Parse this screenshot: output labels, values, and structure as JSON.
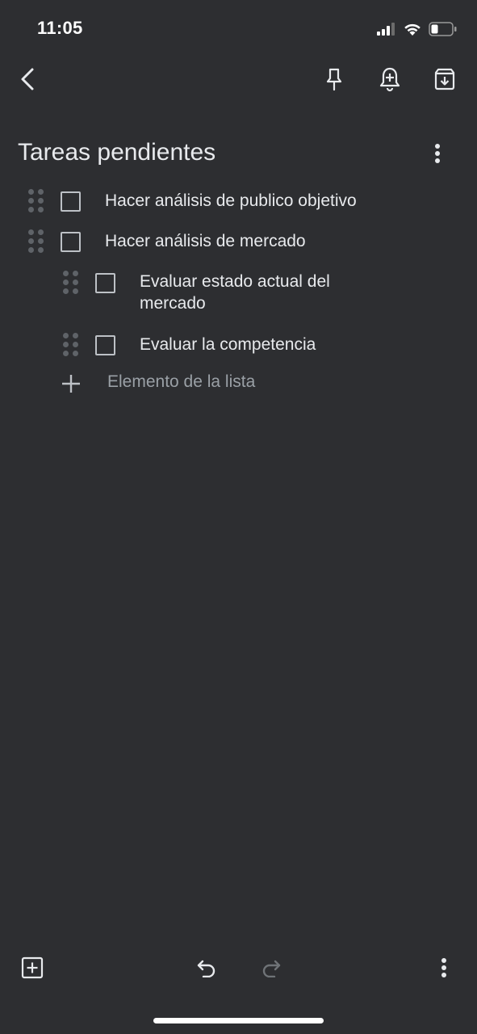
{
  "status_bar": {
    "time": "11:05",
    "icons": [
      "cellular-signal-icon",
      "wifi-icon",
      "battery-icon"
    ]
  },
  "toolbar": {
    "icons": [
      "back-arrow-icon",
      "pin-icon",
      "add-reminder-icon",
      "archive-icon"
    ]
  },
  "note": {
    "title": "Tareas pendientes",
    "items": [
      {
        "text": "Hacer análisis de publico objetivo",
        "checked": false,
        "indent": 0
      },
      {
        "text": "Hacer análisis de mercado",
        "checked": false,
        "indent": 0
      },
      {
        "text": "Evaluar estado actual del mercado",
        "checked": false,
        "indent": 1
      },
      {
        "text": "Evaluar la competencia",
        "checked": false,
        "indent": 1
      }
    ],
    "add_item_placeholder": "Elemento de la lista"
  },
  "bottom_bar": {
    "icons": [
      "add-box-icon",
      "undo-icon",
      "redo-icon",
      "more-vert-icon"
    ]
  },
  "colors": {
    "background": "#2d2e31",
    "text": "#e8eaed",
    "muted": "#9aa0a6"
  }
}
